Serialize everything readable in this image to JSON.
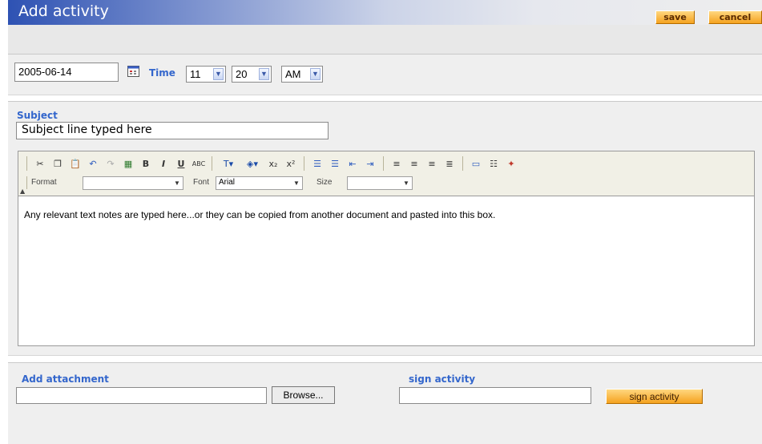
{
  "header": {
    "title": "Add activity",
    "save_label": "save",
    "cancel_label": "cancel"
  },
  "datetime": {
    "date": "2005-06-14",
    "time_label": "Time",
    "hour": "11",
    "minute": "20",
    "ampm": "AM"
  },
  "subject": {
    "label": "Subject",
    "value": "Subject line typed here"
  },
  "editor": {
    "format_label": "Format",
    "format_value": "",
    "font_label": "Font",
    "font_value": "Arial",
    "size_label": "Size",
    "size_value": "",
    "body_text": "Any relevant text notes are typed here...or they can be copied from another document and pasted into this box."
  },
  "attachment": {
    "label": "Add attachment",
    "browse_label": "Browse..."
  },
  "sign": {
    "label": "sign activity",
    "button_label": "sign activity"
  },
  "colors": {
    "accent": "#3366cc",
    "header_blue": "#2e52b3",
    "button_orange": "#f5a21f"
  }
}
